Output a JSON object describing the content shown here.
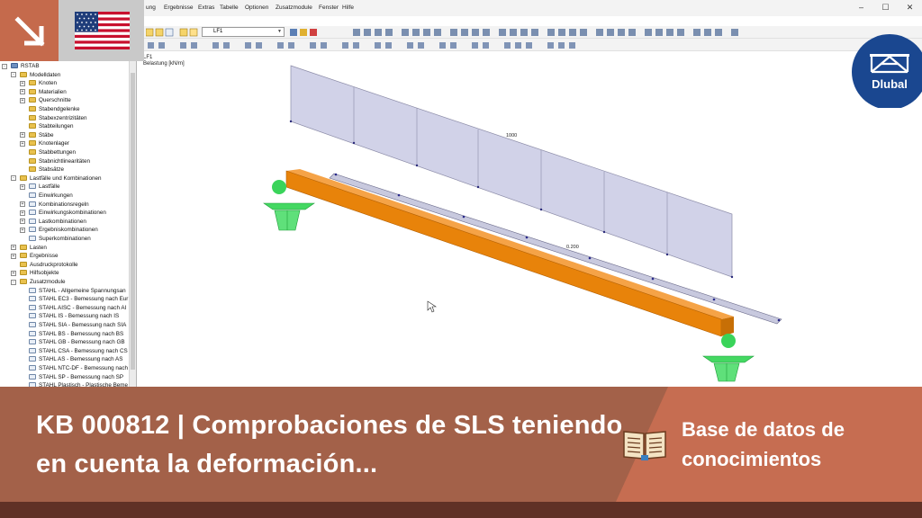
{
  "window": {
    "menus": [
      "ung",
      "Ergebnisse",
      "Extras",
      "Tabelle",
      "Optionen",
      "Zusatzmodule",
      "Fenster",
      "Hilfe"
    ],
    "controls": [
      "–",
      "☐",
      "✕"
    ],
    "loadcase_combo": "LF1"
  },
  "viewport": {
    "label_case": "LF1",
    "label_units": "Belastung [kN/m]",
    "value_top": "1000",
    "value_bottom": "0.200"
  },
  "navigator": {
    "items": [
      {
        "label": "RSTAB",
        "level": 0,
        "icon": "root",
        "toggle": "-"
      },
      {
        "label": "Modelldaten",
        "level": 1,
        "icon": "folder",
        "toggle": "-"
      },
      {
        "label": "Knoten",
        "level": 2,
        "icon": "folder",
        "toggle": "+"
      },
      {
        "label": "Materialien",
        "level": 2,
        "icon": "folder",
        "toggle": "+"
      },
      {
        "label": "Querschnitte",
        "level": 2,
        "icon": "folder",
        "toggle": "+"
      },
      {
        "label": "Stabendgelenke",
        "level": 2,
        "icon": "folder",
        "toggle": ""
      },
      {
        "label": "Stabexzentrizitäten",
        "level": 2,
        "icon": "folder",
        "toggle": ""
      },
      {
        "label": "Stabteilungen",
        "level": 2,
        "icon": "folder",
        "toggle": ""
      },
      {
        "label": "Stäbe",
        "level": 2,
        "icon": "folder",
        "toggle": "+"
      },
      {
        "label": "Knotenlager",
        "level": 2,
        "icon": "folder",
        "toggle": "+"
      },
      {
        "label": "Stabbettungen",
        "level": 2,
        "icon": "folder",
        "toggle": ""
      },
      {
        "label": "Stabnichtlinearitäten",
        "level": 2,
        "icon": "folder",
        "toggle": ""
      },
      {
        "label": "Stabsätze",
        "level": 2,
        "icon": "folder",
        "toggle": ""
      },
      {
        "label": "Lastfälle und Kombinationen",
        "level": 1,
        "icon": "folder",
        "toggle": "-"
      },
      {
        "label": "Lastfälle",
        "level": 2,
        "icon": "page",
        "toggle": "+"
      },
      {
        "label": "Einwirkungen",
        "level": 2,
        "icon": "page",
        "toggle": ""
      },
      {
        "label": "Kombinationsregeln",
        "level": 2,
        "icon": "page",
        "toggle": "+"
      },
      {
        "label": "Einwirkungskombinationen",
        "level": 2,
        "icon": "page",
        "toggle": "+"
      },
      {
        "label": "Lastkombinationen",
        "level": 2,
        "icon": "page",
        "toggle": "+"
      },
      {
        "label": "Ergebniskombinationen",
        "level": 2,
        "icon": "page",
        "toggle": "+"
      },
      {
        "label": "Superkombinationen",
        "level": 2,
        "icon": "page",
        "toggle": ""
      },
      {
        "label": "Lasten",
        "level": 1,
        "icon": "folder",
        "toggle": "+"
      },
      {
        "label": "Ergebnisse",
        "level": 1,
        "icon": "folder",
        "toggle": "+"
      },
      {
        "label": "Ausdruckprotokolle",
        "level": 1,
        "icon": "folder",
        "toggle": ""
      },
      {
        "label": "Hilfsobjekte",
        "level": 1,
        "icon": "folder",
        "toggle": "+"
      },
      {
        "label": "Zusatzmodule",
        "level": 1,
        "icon": "folder",
        "toggle": "-"
      },
      {
        "label": "STAHL - Allgemeine Spannungsan",
        "level": 2,
        "icon": "page",
        "toggle": ""
      },
      {
        "label": "STAHL EC3 - Bemessung nach Eur",
        "level": 2,
        "icon": "page",
        "toggle": ""
      },
      {
        "label": "STAHL AISC - Bemessung nach AI",
        "level": 2,
        "icon": "page",
        "toggle": ""
      },
      {
        "label": "STAHL IS - Bemessung nach IS",
        "level": 2,
        "icon": "page",
        "toggle": ""
      },
      {
        "label": "STAHL SIA - Bemessung nach SIA",
        "level": 2,
        "icon": "page",
        "toggle": ""
      },
      {
        "label": "STAHL BS - Bemessung nach BS",
        "level": 2,
        "icon": "page",
        "toggle": ""
      },
      {
        "label": "STAHL GB - Bemessung nach GB",
        "level": 2,
        "icon": "page",
        "toggle": ""
      },
      {
        "label": "STAHL CSA - Bemessung nach CS",
        "level": 2,
        "icon": "page",
        "toggle": ""
      },
      {
        "label": "STAHL AS - Bemessung nach AS",
        "level": 2,
        "icon": "page",
        "toggle": ""
      },
      {
        "label": "STAHL NTC-DF - Bemessung nach",
        "level": 2,
        "icon": "page",
        "toggle": ""
      },
      {
        "label": "STAHL SP - Bemessung nach SP",
        "level": 2,
        "icon": "page",
        "toggle": ""
      },
      {
        "label": "STAHL Plastisch - Plastische Beme",
        "level": 2,
        "icon": "page",
        "toggle": ""
      }
    ]
  },
  "logo": {
    "text": "Dlubal"
  },
  "banner": {
    "title": "KB 000812 | Comprobaciones de SLS teniendo en cuenta la deformación...",
    "category": "Base de datos de conocimientos"
  },
  "colors": {
    "banner_dark": "#a36149",
    "banner_light": "#c66d51",
    "banner_strip": "#603126",
    "beam": "#e8830a",
    "support": "#33d455",
    "load": "#cfd0e6",
    "logo": "#1a4790"
  },
  "icons": [
    "arrow-down-right-icon",
    "us-flag-icon",
    "dlubal-logo",
    "book-icon",
    "cursor-icon"
  ]
}
